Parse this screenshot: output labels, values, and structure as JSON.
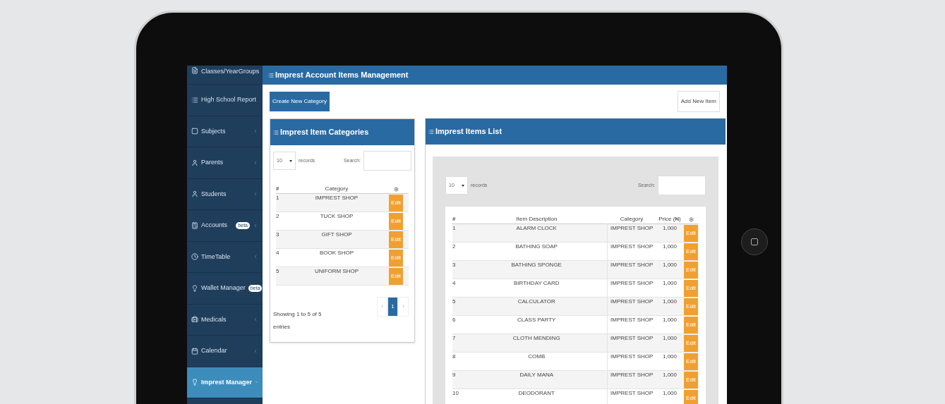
{
  "sidebar": {
    "items": [
      {
        "label": "Classes/YearGroups",
        "selected": false
      },
      {
        "label": "High School Report",
        "selected": false
      },
      {
        "label": "Subjects",
        "selected": false
      },
      {
        "label": "Parents",
        "selected": false
      },
      {
        "label": "Students",
        "selected": false
      },
      {
        "label": "Accounts",
        "badge": "beta",
        "selected": false
      },
      {
        "label": "TimeTable",
        "selected": false
      },
      {
        "label": "Wallet Manager",
        "badge": "beta",
        "selected": false
      },
      {
        "label": "Medicals",
        "selected": false
      },
      {
        "label": "Calendar",
        "selected": false
      },
      {
        "label": "Imprest Manager",
        "selected": true
      }
    ]
  },
  "page": {
    "title": "Imprest Account Items Management",
    "create_button": "Create New Category",
    "add_button": "Add New Item"
  },
  "categories_panel": {
    "title": "Imprest Item Categories",
    "page_size": "10",
    "records_label": "records",
    "search_label": "Search:",
    "columns": [
      "#",
      "Category"
    ],
    "rows": [
      {
        "number": "1",
        "category": "IMPREST SHOP",
        "action": "Edit"
      },
      {
        "number": "2",
        "category": "TUCK SHOP",
        "action": "Edit"
      },
      {
        "number": "3",
        "category": "GIFT SHOP",
        "action": "Edit"
      },
      {
        "number": "4",
        "category": "BOOK SHOP",
        "action": "Edit"
      },
      {
        "number": "5",
        "category": "UNIFORM SHOP",
        "action": "Edit"
      }
    ],
    "info": "Showing 1 to 5 of 5 entries",
    "pagination": [
      {
        "label": "‹",
        "selected": false
      },
      {
        "label": "1",
        "selected": true
      },
      {
        "label": "›",
        "selected": false
      }
    ]
  },
  "items_panel": {
    "title": "Imprest Items List",
    "page_size": "10",
    "records_label": "records",
    "search_label": "Search:",
    "columns": [
      "#",
      "Item Description",
      "Category",
      "Price (₦)"
    ],
    "rows": [
      {
        "number": "1",
        "description": "ALARM CLOCK",
        "category": "IMPREST SHOP",
        "price": "1,000",
        "action": "Edit"
      },
      {
        "number": "2",
        "description": "BATHING SOAP",
        "category": "IMPREST SHOP",
        "price": "1,000",
        "action": "Edit"
      },
      {
        "number": "3",
        "description": "BATHING SPONGE",
        "category": "IMPREST SHOP",
        "price": "1,000",
        "action": "Edit"
      },
      {
        "number": "4",
        "description": "BIRTHDAY CARD",
        "category": "IMPREST SHOP",
        "price": "1,000",
        "action": "Edit"
      },
      {
        "number": "5",
        "description": "CALCULATOR",
        "category": "IMPREST SHOP",
        "price": "1,000",
        "action": "Edit"
      },
      {
        "number": "6",
        "description": "CLASS PARTY",
        "category": "IMPREST SHOP",
        "price": "1,000",
        "action": "Edit"
      },
      {
        "number": "7",
        "description": "CLOTH MENDING",
        "category": "IMPREST SHOP",
        "price": "1,000",
        "action": "Edit"
      },
      {
        "number": "8",
        "description": "COMB",
        "category": "IMPREST SHOP",
        "price": "1,000",
        "action": "Edit"
      },
      {
        "number": "9",
        "description": "DAILY MANA",
        "category": "IMPREST SHOP",
        "price": "1,000",
        "action": "Edit"
      },
      {
        "number": "10",
        "description": "DEODORANT",
        "category": "IMPREST SHOP",
        "price": "1,000",
        "action": "Edit"
      }
    ]
  }
}
